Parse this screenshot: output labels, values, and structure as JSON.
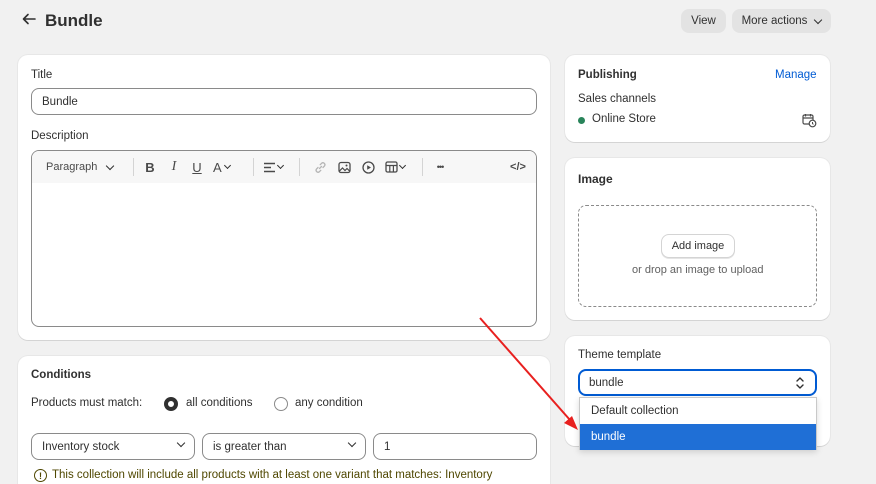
{
  "header": {
    "title": "Bundle",
    "view_label": "View",
    "more_actions_label": "More actions"
  },
  "main": {
    "title_label": "Title",
    "title_value": "Bundle",
    "description_label": "Description",
    "editor": {
      "paragraph_label": "Paragraph",
      "bold": "B",
      "italic": "I",
      "underline": "U",
      "text_color": "A",
      "more": "•••",
      "code": "</>",
      "body": ""
    }
  },
  "conditions": {
    "heading": "Conditions",
    "match_label": "Products must match:",
    "all_label": "all conditions",
    "any_label": "any condition",
    "field_value": "Inventory stock",
    "operator_value": "is greater than",
    "amount_value": "1",
    "notice": "This collection will include all products with at least one variant that matches: Inventory",
    "notice_icon": "!"
  },
  "publishing": {
    "heading": "Publishing",
    "manage_label": "Manage",
    "sales_channels_label": "Sales channels",
    "channel": "Online Store",
    "channel_status_color": "#29845a"
  },
  "image": {
    "heading": "Image",
    "add_button": "Add image",
    "hint": "or drop an image to upload"
  },
  "theme": {
    "heading": "Theme template",
    "selected": "bundle",
    "options": [
      "Default collection",
      "bundle"
    ],
    "highlighted_option": "bundle"
  },
  "colors": {
    "accent": "#005bd3",
    "highlight": "#1f6fd6",
    "annotation_arrow": "#e8201f"
  }
}
